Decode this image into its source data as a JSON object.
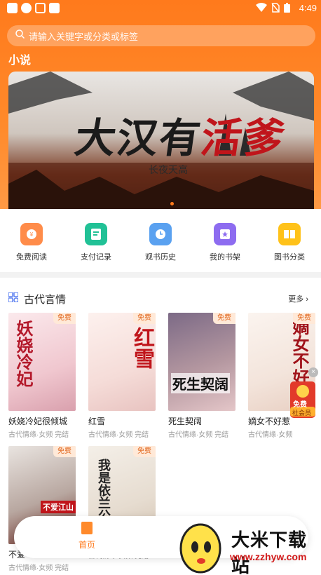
{
  "status_bar": {
    "time": "4:49"
  },
  "search": {
    "placeholder": "请输入关键字或分类或标签"
  },
  "section": {
    "label": "小说"
  },
  "banner": {
    "title_black": "大汉有",
    "title_red": "活爹",
    "author": "长夜天高"
  },
  "quick_links": [
    {
      "label": "免费阅读",
      "icon": "free-read-icon",
      "color": "#ff8c4a"
    },
    {
      "label": "支付记录",
      "icon": "payment-record-icon",
      "color": "#21c196"
    },
    {
      "label": "观书历史",
      "icon": "history-clock-icon",
      "color": "#5aa1f0"
    },
    {
      "label": "我的书架",
      "icon": "bookshelf-star-icon",
      "color": "#8d6cf0"
    },
    {
      "label": "图书分类",
      "icon": "book-category-icon",
      "color": "#ffc21a"
    }
  ],
  "list": {
    "title": "古代言情",
    "more": "更多",
    "free_tag": "免费",
    "books": [
      {
        "title": "妖娆冷妃很倾城",
        "meta": "古代情缘·女频 完结",
        "cover_text": "妖娆冷妃"
      },
      {
        "title": "红雪",
        "meta": "古代情缘·女频 完结",
        "cover_text": "红雪"
      },
      {
        "title": "死生契阔",
        "meta": "古代情缘·女频 完结",
        "cover_text": "死生契阔"
      },
      {
        "title": "嫡女不好惹",
        "meta": "古代情缘·女频",
        "cover_text": "嫡女不好"
      },
      {
        "title": "不爱",
        "meta": "古代情缘·女频 完结",
        "cover_text": "不爱江山"
      },
      {
        "title": "",
        "meta": "古代情缘·女频 完结",
        "cover_text": "我是依兰公"
      }
    ]
  },
  "float": {
    "label_top": "免费",
    "label_bottom": "社会员"
  },
  "bottom_nav": {
    "home": "首页"
  },
  "watermark": {
    "name": "大米下载站",
    "url": "www.zzhyw.com"
  }
}
